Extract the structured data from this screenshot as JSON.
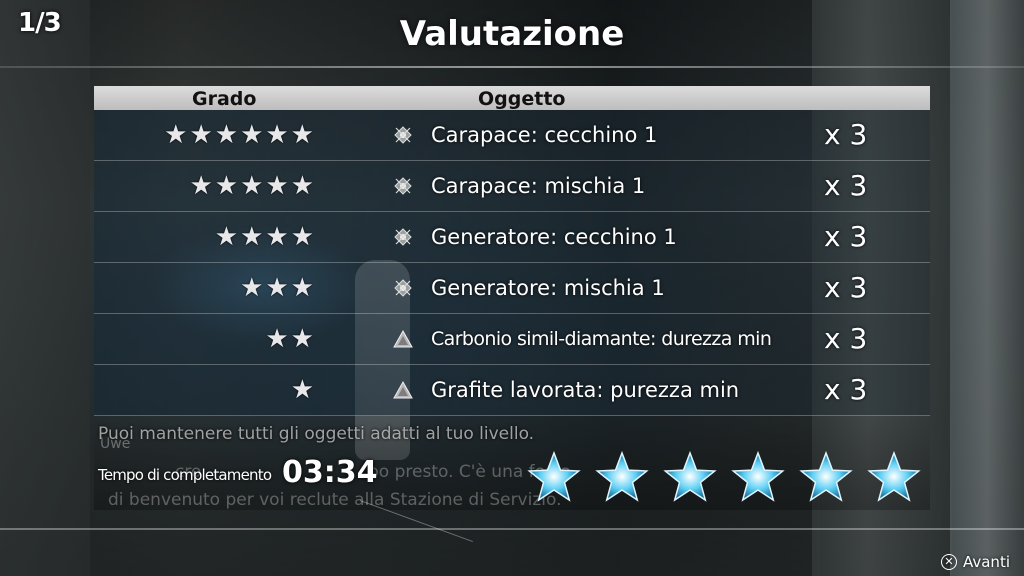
{
  "header": {
    "page_counter": "1/3",
    "title": "Valutazione"
  },
  "table": {
    "columns": [
      "Grado",
      "Oggetto"
    ],
    "rows": [
      {
        "grade_stars": 6,
        "stars_text": "★★★★★★",
        "icon": "chip-icon",
        "item": "Carapace: cecchino 1",
        "qty": "x 3"
      },
      {
        "grade_stars": 5,
        "stars_text": "★★★★★",
        "icon": "chip-icon",
        "item": "Carapace: mischia 1",
        "qty": "x 3"
      },
      {
        "grade_stars": 4,
        "stars_text": "★★★★",
        "icon": "chip-icon",
        "item": "Generatore: cecchino 1",
        "qty": "x 3"
      },
      {
        "grade_stars": 3,
        "stars_text": "★★★",
        "icon": "chip-icon",
        "item": "Generatore: mischia 1",
        "qty": "x 3"
      },
      {
        "grade_stars": 2,
        "stars_text": "★★",
        "icon": "material-triangle-icon",
        "item": "Carbonio simil-diamante: durezza min",
        "qty": "x 3"
      },
      {
        "grade_stars": 1,
        "stars_text": "★",
        "icon": "material-triangle-icon",
        "item": "Grafite lavorata: purezza min",
        "qty": "x 3"
      }
    ]
  },
  "notice": "Puoi mantenere tutti gli oggetti adatti al tuo livello.",
  "background_dialog": {
    "speaker": "Uwe",
    "line1_part1": "cro",
    "line1_part2": "po presto. C'è una festa",
    "line2": "di benvenuto per voi reclute alla Stazione di Servizio."
  },
  "completion": {
    "label": "Tempo di completamento",
    "time": "03:34",
    "rating_stars": 6
  },
  "footer": {
    "button_symbol": "✕",
    "button_label": "Avanti"
  },
  "colors": {
    "header_bar": "#cfcfcf",
    "star_glow": "#5fd0f5",
    "row_bg": "#14283a"
  }
}
